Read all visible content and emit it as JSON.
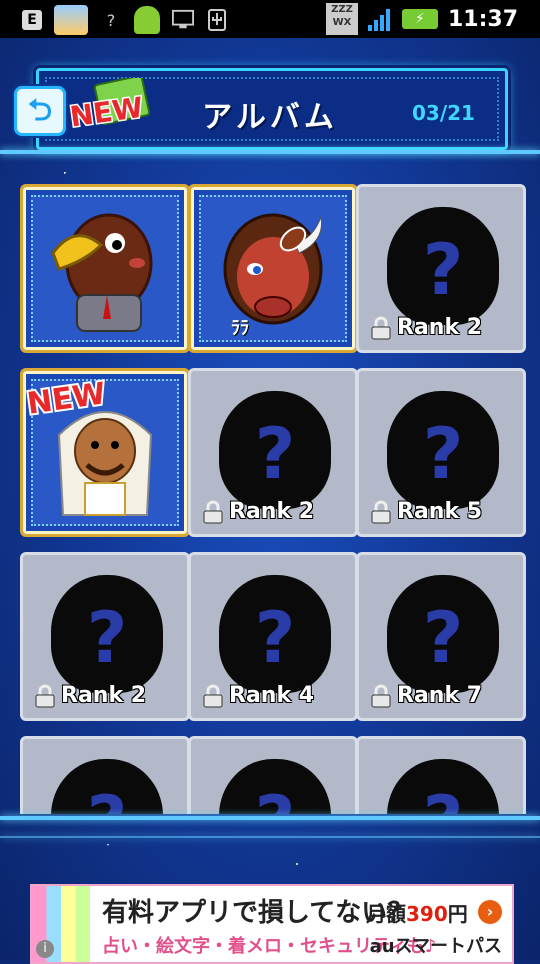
{
  "status_bar": {
    "time": "11:37",
    "zzz_label": "ZZZ",
    "wx_label": "WX",
    "e_label": "E"
  },
  "header": {
    "back_icon": "back-arrow-icon",
    "new_label": "NEW",
    "title": "アルバム",
    "counter": "03/21"
  },
  "album": {
    "cards": [
      {
        "state": "owned",
        "character": "eagle-businessman",
        "new": false
      },
      {
        "state": "owned",
        "character": "red-bison-football",
        "new": false,
        "caption": "ﾗﾗ"
      },
      {
        "state": "locked",
        "rank_label": "Rank 2"
      },
      {
        "state": "owned",
        "character": "camel-sheikh",
        "new": true,
        "new_label": "NEW"
      },
      {
        "state": "locked",
        "rank_label": "Rank 2"
      },
      {
        "state": "locked",
        "rank_label": "Rank 5"
      },
      {
        "state": "locked",
        "rank_label": "Rank 2"
      },
      {
        "state": "locked",
        "rank_label": "Rank 4"
      },
      {
        "state": "locked",
        "rank_label": "Rank 7"
      },
      {
        "state": "locked",
        "rank_label": ""
      },
      {
        "state": "locked",
        "rank_label": ""
      },
      {
        "state": "locked",
        "rank_label": ""
      }
    ],
    "question_mark": "?"
  },
  "ad": {
    "headline": "有料アプリで損してない？",
    "price_prefix": "月額",
    "price_value": "390",
    "price_suffix": "円",
    "subline": "占い・絵文字・着メロ・セキュリティも♪",
    "brand": "auスマートパス",
    "info": "i"
  },
  "colors": {
    "accent": "#39d3ff",
    "gold_frame": "#d9a834",
    "locked_card": "#b4b9c9"
  }
}
